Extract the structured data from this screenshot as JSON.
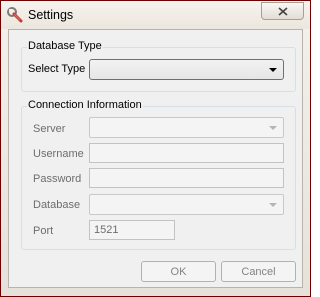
{
  "window": {
    "title": "Settings",
    "icon": "settings-wrench-icon"
  },
  "database_type": {
    "group_title": "Database Type",
    "select_type_label": "Select Type",
    "select_type_value": ""
  },
  "connection": {
    "group_title": "Connection Information",
    "server_label": "Server",
    "server_value": "",
    "username_label": "Username",
    "username_value": "",
    "password_label": "Password",
    "password_value": "",
    "database_label": "Database",
    "database_value": "",
    "port_label": "Port",
    "port_value": "1521"
  },
  "buttons": {
    "ok": "OK",
    "cancel": "Cancel"
  }
}
